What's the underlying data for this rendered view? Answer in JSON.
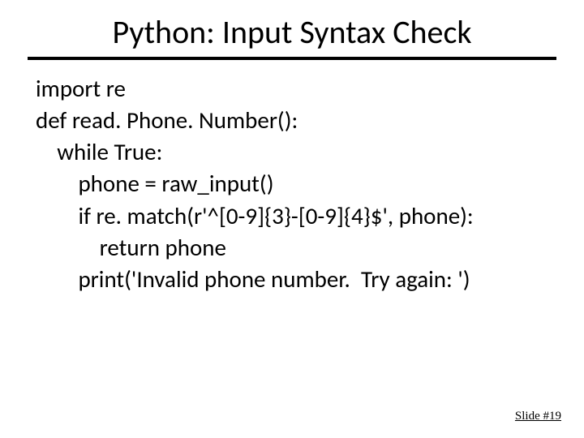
{
  "title": "Python: Input Syntax Check",
  "code": {
    "l1": "import re",
    "l2": "def read. Phone. Number():",
    "l3": "    while True:",
    "l4": "        phone = raw_input()",
    "l5": "        if re. match(r'^[0-9]{3}-[0-9]{4}$', phone):",
    "l6": "            return phone",
    "l7": "        print('Invalid phone number.  Try again: ')"
  },
  "footer": "Slide #19"
}
